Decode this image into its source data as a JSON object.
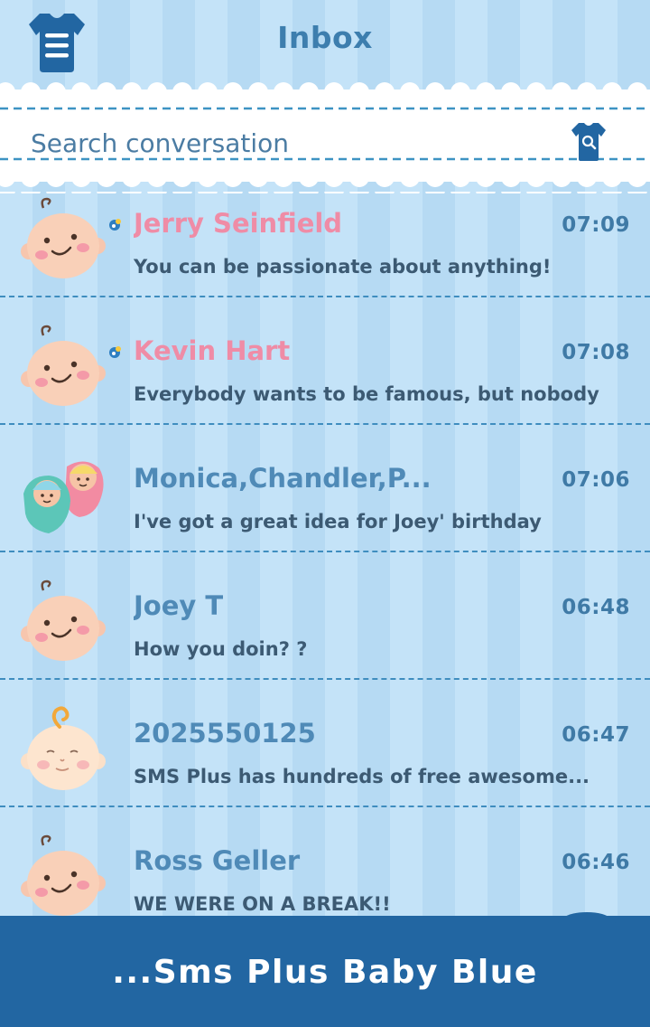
{
  "header": {
    "title": "Inbox",
    "menu_icon": "onesie-menu-icon"
  },
  "search": {
    "placeholder": "Search conversation",
    "icon": "onesie-search-icon"
  },
  "colors": {
    "accent": "#2266a2",
    "unread_name": "#ef8ca6",
    "read_name": "#4f8ab7",
    "background": "#bfe0f6"
  },
  "conversations": [
    {
      "name": "Jerry Seinfield",
      "time": "07:09",
      "preview": "You can be passionate about anything!",
      "unread": true,
      "avatar": "baby-face-avatar"
    },
    {
      "name": "Kevin Hart",
      "time": "07:08",
      "preview": "Everybody wants to be famous, but nobody",
      "unread": true,
      "avatar": "baby-face-avatar"
    },
    {
      "name": "Monica,Chandler,P...",
      "time": "07:06",
      "preview": "I've got a great idea for Joey' birthday",
      "unread": false,
      "avatar": "swaddled-twins-avatar"
    },
    {
      "name": "Joey T",
      "time": "06:48",
      "preview": "How you doin? ?",
      "unread": false,
      "avatar": "baby-face-avatar"
    },
    {
      "name": "2025550125",
      "time": "06:47",
      "preview": "SMS Plus has hundreds of free awesome...",
      "unread": false,
      "avatar": "baby-face-curl-avatar"
    },
    {
      "name": "Ross Geller",
      "time": "06:46",
      "preview": "WE WERE ON A BREAK!!",
      "unread": false,
      "avatar": "baby-face-avatar"
    }
  ],
  "banner": {
    "text": "...Sms Plus Baby Blue"
  }
}
